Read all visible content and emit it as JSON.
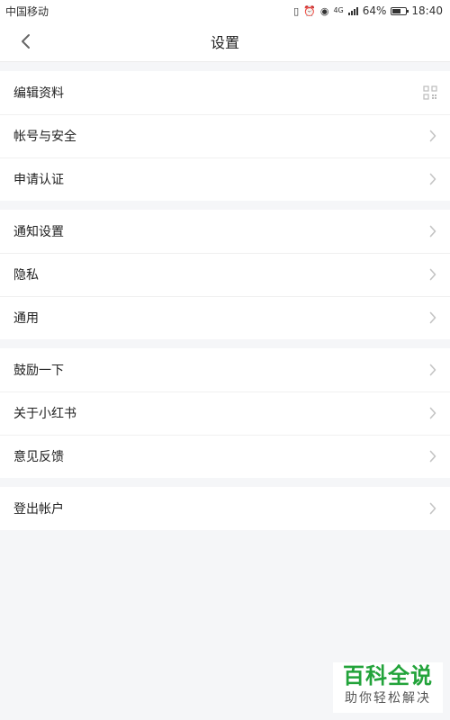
{
  "status_bar": {
    "carrier": "中国移动",
    "network_label": "4G",
    "battery_percent_label": "64%",
    "battery_level": 0.64,
    "time": "18:40"
  },
  "nav": {
    "title": "设置",
    "back_icon": "chevron-left-icon"
  },
  "groups": [
    {
      "items": [
        {
          "label": "编辑资料",
          "trailing_icon": "qr-code-icon"
        },
        {
          "label": "帐号与安全",
          "trailing_icon": "chevron-right-icon"
        },
        {
          "label": "申请认证",
          "trailing_icon": "chevron-right-icon"
        }
      ]
    },
    {
      "items": [
        {
          "label": "通知设置",
          "trailing_icon": "chevron-right-icon"
        },
        {
          "label": "隐私",
          "trailing_icon": "chevron-right-icon"
        },
        {
          "label": "通用",
          "trailing_icon": "chevron-right-icon"
        }
      ]
    },
    {
      "items": [
        {
          "label": "鼓励一下",
          "trailing_icon": "chevron-right-icon"
        },
        {
          "label": "关于小红书",
          "trailing_icon": "chevron-right-icon"
        },
        {
          "label": "意见反馈",
          "trailing_icon": "chevron-right-icon"
        }
      ]
    },
    {
      "items": [
        {
          "label": "登出帐户",
          "trailing_icon": "chevron-right-icon"
        }
      ]
    }
  ],
  "watermark": {
    "title": "百科全说",
    "subtitle": "助你轻松解决"
  },
  "colors": {
    "page_background": "#f5f6f8",
    "row_background": "#ffffff",
    "chevron": "#c4c4c4",
    "watermark_green": "#22a33a"
  }
}
